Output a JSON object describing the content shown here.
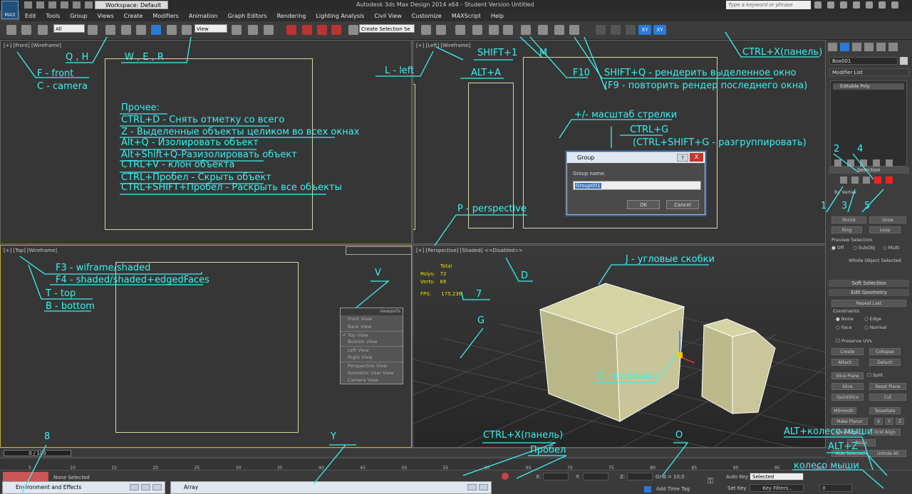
{
  "window": {
    "title": "Autodesk 3ds Max Design 2014 x64  -  Student Version   Untitled",
    "workspace": "Workspace: Default",
    "search_placeholder": "Type a keyword or phrase",
    "logo": "MAX"
  },
  "menu": [
    "Edit",
    "Tools",
    "Group",
    "Views",
    "Create",
    "Modifiers",
    "Animation",
    "Graph Editors",
    "Rendering",
    "Lighting Analysis",
    "Civil View",
    "Customize",
    "MAXScript",
    "Help"
  ],
  "toolbar": {
    "selection_filter": "All",
    "ref_coord": "View",
    "named_selection": "Create Selection Se",
    "axis_xy": "XY",
    "axis_xy2": "XY"
  },
  "viewports": {
    "front": "[+] [Front] [Wireframe]",
    "left": "[+] [Left] [Wireframe]",
    "top": "[+] [Top] [Wireframe]",
    "perspective": "[+] [Perspective] [Shaded]  <<Disabled>>"
  },
  "stats": {
    "total": "Total",
    "polys_label": "Polys:",
    "polys": "72",
    "verts_label": "Verts:",
    "verts": "88",
    "fps_label": "FPS:",
    "fps": "175,236"
  },
  "viewport_menu": {
    "header": "viewports",
    "items": [
      "Front View",
      "Back View",
      "Top View",
      "Bottom View",
      "Left View",
      "Right View",
      "Perspective View",
      "Isometric User View",
      "Camera View"
    ],
    "checked": "Top View"
  },
  "group_dialog": {
    "title": "Group",
    "help": "?",
    "close": "X",
    "label": "Group name:",
    "value": "Group001",
    "ok": "OK",
    "cancel": "Cancel"
  },
  "command_panel": {
    "object_name": "Box001",
    "modifier_list": "Modifier List",
    "stack_item": "Editable Poly",
    "selection": "Selection",
    "by_vertex": "By Vertex",
    "shrink": "Shrink",
    "grow": "Grow",
    "ring": "Ring",
    "loop": "Loop",
    "preview_selection": "Preview Selection",
    "off": "Off",
    "subobj": "SubObj",
    "multi": "Multi",
    "whole_object": "Whole Object Selected",
    "soft_selection": "Soft Selection",
    "edit_geometry": "Edit Geometry",
    "repeat_last": "Repeat Last",
    "constraints": "Constraints",
    "none": "None",
    "edge": "Edge",
    "face": "Face",
    "normal": "Normal",
    "preserve_uvs": "Preserve UVs",
    "create": "Create",
    "collapse": "Collapse",
    "attach": "Attach",
    "detach": "Detach",
    "slice_plane": "Slice Plane",
    "split": "Split",
    "slice": "Slice",
    "reset_plane": "Reset Plane",
    "quickslice": "QuickSlice",
    "cut": "Cut",
    "msmooth": "MSmooth",
    "tessellate": "Tessellate",
    "make_planar": "Make Planar",
    "x": "X",
    "y": "Y",
    "z": "Z",
    "view_align": "View Align",
    "grid_align": "Grid Align",
    "relax": "Relax",
    "hide_selected": "Hide Selected",
    "unhide_all": "Unhide All"
  },
  "timeline": {
    "slider": "0 / 100",
    "ticks": [
      "5",
      "10",
      "15",
      "20",
      "25",
      "30",
      "35",
      "40",
      "45",
      "50",
      "55",
      "60",
      "65",
      "70",
      "75",
      "80",
      "85",
      "90",
      "95",
      "100"
    ]
  },
  "status": {
    "none_selected": "None Selected",
    "x_label": "X:",
    "y_label": "Y:",
    "z_label": "Z:",
    "grid": "Grid = 10,0",
    "add_time_tag": "Add Time Tag",
    "auto_key": "Auto Key",
    "auto_key_value": "Selected",
    "set_key": "Set Key",
    "key_filters": "Key Filters...",
    "frame": "0"
  },
  "taskbar": {
    "env": "Environment and Effects",
    "array": "Array"
  },
  "annotations": {
    "q_h": "Q , H",
    "w_e_r": "W , E , R",
    "f_front": "F - front",
    "c_camera": "C - camera",
    "prochee": "Прочее:",
    "ctrl_d": "CTRL+D - Снять отметку со всего",
    "z_zoom": "Z - Выделенные объекты целиком во всех окнах",
    "alt_q": "Alt+Q - Изолировать объект",
    "alt_shift_q": "Alt+Shift+Q-Разизолировать объект",
    "ctrl_v": "CTRL+V - клон объекта",
    "ctrl_space": "CTRL+Пробел - Скрыть объект",
    "ctrl_shift_space": "CTRL+SHIFT+Пробел - Раскрыть все объекты",
    "l_left": "L - left",
    "shift_1": "SHIFT+1",
    "alt_a": "ALT+A",
    "m": "M",
    "f10": "F10",
    "shift_q": "SHIFT+Q - рендерить выделенное окно",
    "f9": "(F9 - повторить рендер последнего окна)",
    "ctrl_x_top": "CTRL+X(панель)",
    "plus_minus": "+/- масштаб стрелки",
    "ctrl_g": "CTRL+G",
    "ctrl_shift_g": "(CTRL+SHIFT+G - разгруппировать)",
    "n2": "2",
    "n4": "4",
    "n1": "1",
    "n3": "3",
    "n5": "5",
    "p_persp": "P - perspective",
    "f3": "F3 - wiframe/shaded",
    "f4": "F4 - shaded/shaded+edgedFaces",
    "t_top": "T - top",
    "b_bottom": "B - bottom",
    "v": "V",
    "d": "D",
    "n7": "7",
    "j": "J - угловые скобки",
    "g": "G",
    "x_toggle": "X - вкл/выкл",
    "n8": "8",
    "y": "Y",
    "ctrl_x_bottom": "CTRL+X(панель)",
    "probel": "Пробел",
    "o": "O",
    "alt_wheel": "ALT+колесо мыши",
    "alt_z": "ALT+Z",
    "wheel": "колесо мыши"
  }
}
